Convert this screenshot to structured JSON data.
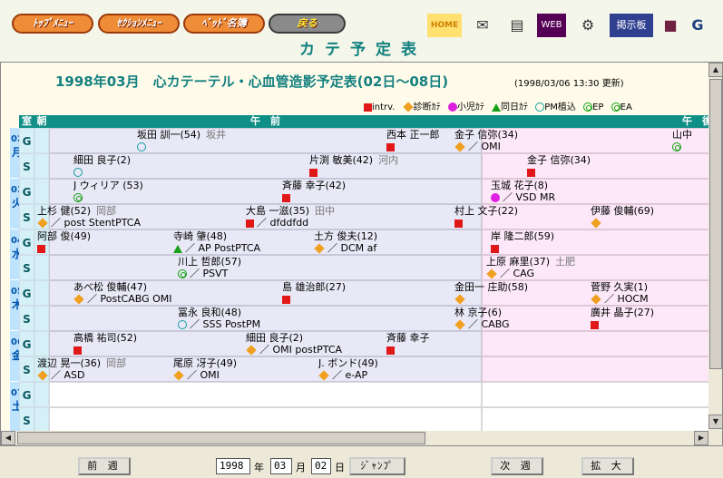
{
  "nav": {
    "top_menu": "ﾄｯﾌﾟﾒﾆｭｰ",
    "section_menu": "ｾｸｼｮﾝﾒﾆｭｰ",
    "bed_list": "ﾍﾞｯﾄﾞ名簿",
    "back": "戻る",
    "icons": [
      "home-icon",
      "mail-icon",
      "memo-icon",
      "web-icon",
      "sitemap-icon",
      "bbs-icon",
      "book-icon",
      "logo-icon"
    ],
    "home_label": "HOME",
    "bbs_label": "掲示板"
  },
  "page_title": "カテ予定表",
  "schedule": {
    "title": "1998年03月　心カテーテル・心血管造影予定表(02日～08日)",
    "updated": "(1998/03/06 13:30 更新)"
  },
  "legend": [
    {
      "icon": "square-red",
      "label": "intrv."
    },
    {
      "icon": "diamond-orange",
      "label": "診断ｶﾃ"
    },
    {
      "icon": "dot-magenta",
      "label": "小児ｶﾃ"
    },
    {
      "icon": "triangle-green",
      "label": "同日ｶﾃ"
    },
    {
      "icon": "circle-teal",
      "label": "PM植込"
    },
    {
      "icon": "double-circle",
      "label": "EP"
    },
    {
      "icon": "double-circle",
      "label": "EA"
    }
  ],
  "grid": {
    "hdr_room": "室",
    "hdr_morning": "朝",
    "hdr_am": "午　前",
    "hdr_pm": "午　後",
    "days": [
      {
        "num": "02",
        "wd": "月"
      },
      {
        "num": "03",
        "wd": "火"
      },
      {
        "num": "04",
        "wd": "水"
      },
      {
        "num": "05",
        "wd": "木"
      },
      {
        "num": "06",
        "wd": "金"
      },
      {
        "num": "07",
        "wd": "土"
      }
    ],
    "rooms": [
      "G",
      "S",
      "G",
      "S",
      "G",
      "S",
      "G",
      "S",
      "G",
      "S",
      "G",
      "S"
    ],
    "events": [
      {
        "r": 0,
        "name": "坂田 訓一(54)",
        "doc": "坂井",
        "marks": "cir",
        "note": ""
      },
      {
        "r": 0,
        "name": "西本 正一郎",
        "doc": "",
        "marks": "sq",
        "note": ""
      },
      {
        "r": 0,
        "name": "金子 信弥(34)",
        "doc": "",
        "marks": "dia",
        "note": "／ OMI"
      },
      {
        "r": 0,
        "name": "山中",
        "doc": "",
        "marks": "dbl",
        "note": ""
      },
      {
        "r": 1,
        "name": "細田 良子(2)",
        "doc": "",
        "marks": "cir",
        "note": ""
      },
      {
        "r": 1,
        "name": "片渕 敏美(42)",
        "doc": "河内",
        "marks": "sq",
        "note": ""
      },
      {
        "r": 1,
        "name": "金子 信弥(34)",
        "doc": "",
        "marks": "sq",
        "note": ""
      },
      {
        "r": 2,
        "name": "J ウィリア (53)",
        "doc": "",
        "marks": "dbl",
        "note": ""
      },
      {
        "r": 2,
        "name": "斉藤 幸子(42)",
        "doc": "",
        "marks": "sq",
        "note": ""
      },
      {
        "r": 2,
        "name": "玉城 花子(8)",
        "doc": "",
        "marks": "mag",
        "note": "／ VSD MR"
      },
      {
        "r": 3,
        "name": "上杉 健(52)",
        "doc": "岡部",
        "marks": "dia",
        "note": "／ post StentPTCA"
      },
      {
        "r": 3,
        "name": "大島 一滋(35)",
        "doc": "田中",
        "marks": "sq",
        "note": "／ dfddfdd"
      },
      {
        "r": 3,
        "name": "村上 文子(22)",
        "doc": "",
        "marks": "sq",
        "note": ""
      },
      {
        "r": 3,
        "name": "伊藤 俊輔(69)",
        "doc": "",
        "marks": "dia",
        "note": ""
      },
      {
        "r": 4,
        "name": "阿部 俊(49)",
        "doc": "",
        "marks": "sq",
        "note": ""
      },
      {
        "r": 4,
        "name": "寺崎 肇(48)",
        "doc": "",
        "marks": "tri",
        "note": "／ AP PostPTCA"
      },
      {
        "r": 4,
        "name": "土方 俊夫(12)",
        "doc": "",
        "marks": "dia",
        "note": "／ DCM af"
      },
      {
        "r": 4,
        "name": "岸 隆二郎(59)",
        "doc": "",
        "marks": "sq",
        "note": ""
      },
      {
        "r": 5,
        "name": "川上 哲郎(57)",
        "doc": "",
        "marks": "dbl",
        "note": "／ PSVT"
      },
      {
        "r": 5,
        "name": "上原 麻里(37)",
        "doc": "土肥",
        "marks": "dia",
        "note": "／ CAG"
      },
      {
        "r": 6,
        "name": "あべ松 俊輔(47)",
        "doc": "",
        "marks": "dia",
        "note": "／ PostCABG OMI"
      },
      {
        "r": 6,
        "name": "島 雄治郎(27)",
        "doc": "",
        "marks": "sq",
        "note": ""
      },
      {
        "r": 6,
        "name": "金田一 庄助(58)",
        "doc": "",
        "marks": "dia",
        "note": ""
      },
      {
        "r": 6,
        "name": "菅野 久実(1)",
        "doc": "",
        "marks": "dia",
        "note": "／ HOCM"
      },
      {
        "r": 7,
        "name": "冨永 良和(48)",
        "doc": "",
        "marks": "cir",
        "note": "／ SSS PostPM"
      },
      {
        "r": 7,
        "name": "林 京子(6)",
        "doc": "",
        "marks": "dia",
        "note": "／ CABG"
      },
      {
        "r": 7,
        "name": "廣井 晶子(27)",
        "doc": "",
        "marks": "sq",
        "note": ""
      },
      {
        "r": 8,
        "name": "高橋 祐司(52)",
        "doc": "",
        "marks": "sq",
        "note": ""
      },
      {
        "r": 8,
        "name": "細田 良子(2)",
        "doc": "",
        "marks": "dia",
        "note": "／ OMI postPTCA"
      },
      {
        "r": 8,
        "name": "斉藤 幸子",
        "doc": "",
        "marks": "sq",
        "note": ""
      },
      {
        "r": 9,
        "name": "渡辺 晃一(36)",
        "doc": "岡部",
        "marks": "dia",
        "note": "／ ASD"
      },
      {
        "r": 9,
        "name": "尾原 冴子(49)",
        "doc": "",
        "marks": "dia",
        "note": "／ OMI"
      },
      {
        "r": 9,
        "name": "J. ボンド(49)",
        "doc": "",
        "marks": "dia",
        "note": "／ e-AP"
      }
    ]
  },
  "footer": {
    "prev_week": "前 週",
    "year": "1998",
    "year_lbl": "年",
    "month": "03",
    "month_lbl": "月",
    "day": "02",
    "day_lbl": "日",
    "jump": "ｼﾞｬﾝﾌﾟ",
    "next_week": "次 週",
    "zoom": "拡 大"
  }
}
